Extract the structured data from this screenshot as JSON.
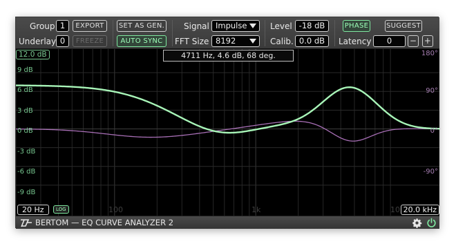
{
  "toolbar": {
    "group_label": "Group",
    "group_value": "1",
    "export_label": "EXPORT",
    "underlay_label": "Underlay",
    "underlay_value": "0",
    "freeze_label": "FREEZE",
    "set_as_gen_label": "SET AS GEN.",
    "auto_sync_label": "AUTO SYNC",
    "signal_label": "Signal",
    "signal_value": "Impulse",
    "fft_label": "FFT Size",
    "fft_value": "8192",
    "level_label": "Level",
    "level_value": "-18 dB",
    "calib_label": "Calib.",
    "calib_value": "0.0 dB",
    "phase_label": "PHASE",
    "suggest_label": "SUGGEST",
    "latency_label": "Latency",
    "latency_value": "0",
    "minus_label": "−",
    "plus_label": "+"
  },
  "graph": {
    "readout": "4711 Hz, 4.6 dB, 68 deg.",
    "y_max": "12.0 dB",
    "db_labels": [
      "9 dB",
      "6 dB",
      "3 dB",
      "0 dB",
      "-3 dB",
      "-6 dB",
      "-9 dB"
    ],
    "phase_labels": [
      "180°",
      "90°",
      "0°",
      "-90°"
    ],
    "x_min": "20 Hz",
    "log_label": "LOG",
    "x_max": "20.0 kHz",
    "x_ticks": [
      "100",
      "1k",
      "10k"
    ]
  },
  "footer": {
    "brand": "BERTOM — EQ CURVE ANALYZER 2"
  },
  "colors": {
    "magnitude": "#a8f5b8",
    "phase": "#a86fb6",
    "grid": "#2b2b2b",
    "accent": "#7fe9a0"
  }
}
